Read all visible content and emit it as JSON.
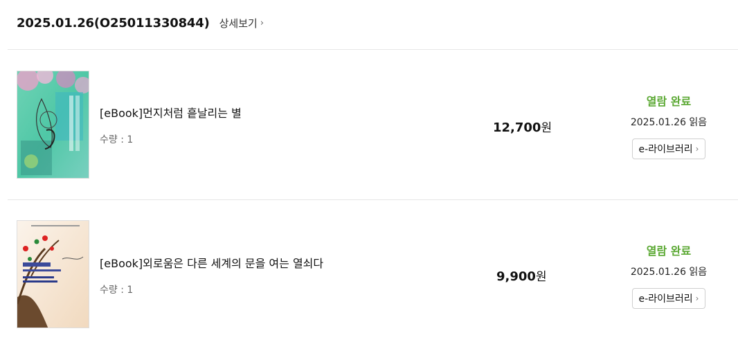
{
  "order": {
    "id_text": "2025.01.26(O25011330844)",
    "detail_label": "상세보기",
    "detail_chevron": "›"
  },
  "items": [
    {
      "title": "[eBook]먼지처럼 흩날리는 별",
      "quantity": "수량 : 1",
      "price_value": "12,700",
      "price_unit": "원",
      "status": "열람 완료",
      "read_date": "2025.01.26 읽음",
      "library_button": "e-라이브러리",
      "cover_icon": "book-cover-image"
    },
    {
      "title": "[eBook]외로움은 다른 세계의 문을 여는 열쇠다",
      "quantity": "수량 : 1",
      "price_value": "9,900",
      "price_unit": "원",
      "status": "열람 완료",
      "read_date": "2025.01.26 읽음",
      "library_button": "e-라이브러리",
      "cover_icon": "book-cover-image"
    }
  ],
  "colors": {
    "status_green": "#5aa832",
    "divider": "#e6e6e6"
  }
}
